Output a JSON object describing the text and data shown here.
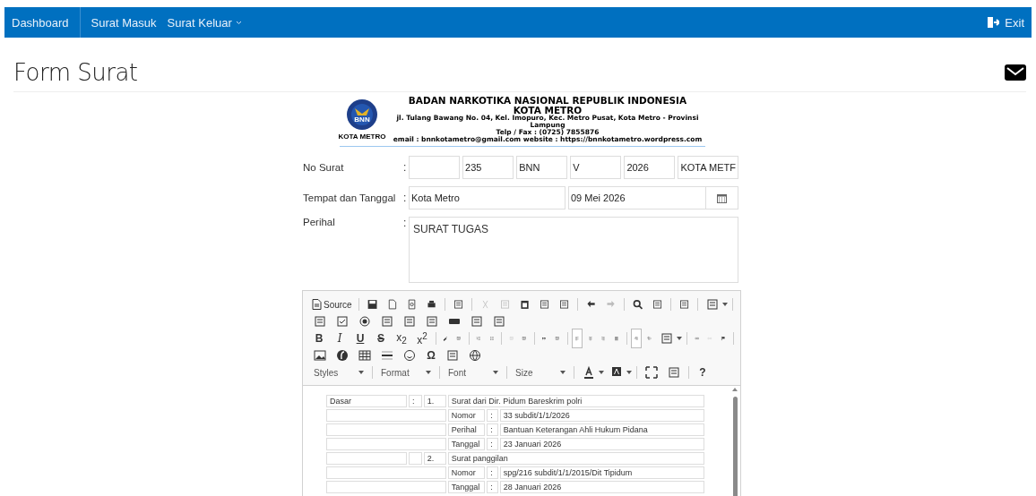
{
  "navbar": {
    "items": [
      {
        "label": "Dashboard",
        "kind": "link",
        "selected": false
      },
      {
        "label": "Surat Masuk",
        "kind": "link",
        "selected": false
      },
      {
        "label": "Surat Keluar",
        "kind": "dropdown",
        "selected": false
      }
    ],
    "exit": "Exit"
  },
  "page_title": "Form Surat",
  "letterhead": {
    "logo_text": "BNN",
    "logo_caption": "KOTA METRO",
    "lines": [
      "BADAN NARKOTIKA NASIONAL REPUBLIK INDONESIA",
      "KOTA METRO",
      "jl. Tulang Bawang No. 04, Kel. Imopuro, Kec. Metro Pusat, Kota Metro - Provinsi Lampung",
      "Telp / Fax : (0725) 7855876",
      "email : bnnkotametro@gmail.com website : https://bnnkotametro.wordpress.com"
    ]
  },
  "form": {
    "no_surat": {
      "label": "No Surat",
      "colon": ":",
      "parts": [
        {
          "kind": "empty"
        },
        {
          "kind": "filled",
          "value": "235"
        },
        {
          "kind": "filled",
          "value": "BNN"
        },
        {
          "kind": "filled",
          "value": "V"
        },
        {
          "kind": "filled",
          "value": "2026"
        },
        {
          "kind": "filled",
          "value": "KOTA METF"
        }
      ]
    },
    "tempat_tanggal": {
      "label": "Tempat dan Tanggal",
      "colon": ":",
      "place": "Kota Metro",
      "date": "09 Mei 2026"
    },
    "perihal": {
      "label": "Perihal",
      "colon": ":",
      "value": "SURAT TUGAS"
    }
  },
  "toolbar": [
    [
      {
        "kind": "source",
        "text": "Source",
        "disabled": false
      },
      {
        "kind": "sep"
      },
      {
        "kind": "icon",
        "disabled": false,
        "on": false
      },
      {
        "kind": "icon",
        "disabled": false,
        "on": false
      },
      {
        "kind": "icon",
        "disabled": false,
        "on": false
      },
      {
        "kind": "icon",
        "disabled": false,
        "on": false
      },
      {
        "kind": "sep"
      },
      {
        "kind": "icon",
        "disabled": false,
        "on": false
      },
      {
        "kind": "sep"
      },
      {
        "kind": "icon",
        "disabled": true,
        "on": false
      },
      {
        "kind": "icon",
        "disabled": true,
        "on": false
      },
      {
        "kind": "icon",
        "disabled": false,
        "on": false
      },
      {
        "kind": "icon",
        "disabled": false,
        "on": false
      },
      {
        "kind": "icon",
        "disabled": false,
        "on": false
      },
      {
        "kind": "sep"
      },
      {
        "kind": "icon",
        "disabled": false,
        "on": false
      },
      {
        "kind": "icon",
        "disabled": true,
        "on": false
      },
      {
        "kind": "sep"
      },
      {
        "kind": "icon",
        "disabled": false,
        "on": false
      },
      {
        "kind": "icon",
        "disabled": false,
        "on": false
      },
      {
        "kind": "sep"
      },
      {
        "kind": "icon",
        "disabled": false,
        "on": false
      },
      {
        "kind": "sep"
      },
      {
        "kind": "icon",
        "disabled": false,
        "on": false
      },
      {
        "kind": "sep"
      }
    ],
    [
      {
        "kind": "icon",
        "disabled": false,
        "on": false
      },
      {
        "kind": "icon",
        "disabled": false,
        "on": false
      },
      {
        "kind": "icon",
        "disabled": false,
        "on": false
      },
      {
        "kind": "icon",
        "disabled": false,
        "on": false
      },
      {
        "kind": "icon",
        "disabled": false,
        "on": false
      },
      {
        "kind": "icon",
        "disabled": false,
        "on": false
      },
      {
        "kind": "icon",
        "disabled": false,
        "on": false
      },
      {
        "kind": "icon",
        "disabled": false,
        "on": false
      },
      {
        "kind": "icon",
        "disabled": false,
        "on": false
      }
    ],
    [
      {
        "kind": "glyph",
        "text": "B",
        "disabled": false,
        "on": false
      },
      {
        "kind": "glyph",
        "text": "I",
        "disabled": false,
        "on": false
      },
      {
        "kind": "glyph",
        "text": "U",
        "disabled": false,
        "on": false
      },
      {
        "kind": "glyph",
        "text": "S",
        "disabled": false,
        "on": false
      },
      {
        "kind": "glyph",
        "text": "x$_{2}$",
        "disabled": false,
        "on": false
      },
      {
        "kind": "glyph",
        "text": "x$^{2}$",
        "disabled": false,
        "on": false
      },
      {
        "kind": "sep"
      },
      {
        "kind": "icon",
        "disabled": false,
        "on": false
      },
      {
        "kind": "icon",
        "disabled": false,
        "on": false
      },
      {
        "kind": "sep"
      },
      {
        "kind": "icon",
        "disabled": false,
        "on": false
      },
      {
        "kind": "icon",
        "disabled": false,
        "on": false
      },
      {
        "kind": "sep"
      },
      {
        "kind": "icon",
        "disabled": true,
        "on": false
      },
      {
        "kind": "icon",
        "disabled": false,
        "on": false
      },
      {
        "kind": "sep"
      },
      {
        "kind": "icon",
        "disabled": false,
        "on": false
      },
      {
        "kind": "icon",
        "disabled": false,
        "on": false
      },
      {
        "kind": "sep"
      },
      {
        "kind": "icon",
        "disabled": false,
        "on": true
      },
      {
        "kind": "icon",
        "disabled": false,
        "on": false
      },
      {
        "kind": "icon",
        "disabled": false,
        "on": false
      },
      {
        "kind": "icon",
        "disabled": false,
        "on": false
      },
      {
        "kind": "sep"
      },
      {
        "kind": "icon",
        "disabled": false,
        "on": true
      },
      {
        "kind": "icon",
        "disabled": false,
        "on": false
      },
      {
        "kind": "icon",
        "disabled": false,
        "on": false
      },
      {
        "kind": "sep"
      },
      {
        "kind": "icon",
        "disabled": false,
        "on": false
      },
      {
        "kind": "icon",
        "disabled": true,
        "on": false
      },
      {
        "kind": "icon",
        "disabled": false,
        "on": false
      },
      {
        "kind": "sep"
      }
    ],
    [
      {
        "kind": "icon",
        "disabled": false,
        "on": false
      },
      {
        "kind": "icon",
        "disabled": false,
        "on": false
      },
      {
        "kind": "icon",
        "disabled": false,
        "on": false
      },
      {
        "kind": "icon",
        "disabled": false,
        "on": false
      },
      {
        "kind": "icon",
        "disabled": false,
        "on": false
      },
      {
        "kind": "glyph",
        "text": "Ω",
        "disabled": false,
        "on": false
      },
      {
        "kind": "icon",
        "disabled": false,
        "on": false
      },
      {
        "kind": "icon",
        "disabled": false,
        "on": false
      }
    ],
    [
      {
        "kind": "combo",
        "text": "Styles",
        "disabled": false
      },
      {
        "kind": "sep"
      },
      {
        "kind": "combo",
        "text": "Format",
        "disabled": false
      },
      {
        "kind": "sep"
      },
      {
        "kind": "combo",
        "text": "Font",
        "disabled": false
      },
      {
        "kind": "sep"
      },
      {
        "kind": "combo",
        "text": "Size",
        "disabled": false
      },
      {
        "kind": "sep"
      },
      {
        "kind": "icon",
        "disabled": false,
        "on": false
      },
      {
        "kind": "icon",
        "disabled": false,
        "on": false
      },
      {
        "kind": "sep"
      },
      {
        "kind": "icon",
        "disabled": false,
        "on": false
      },
      {
        "kind": "icon",
        "disabled": false,
        "on": false
      },
      {
        "kind": "sep"
      },
      {
        "kind": "glyph",
        "text": "?",
        "disabled": false,
        "on": false
      }
    ]
  ],
  "document": {
    "rows": [
      {
        "kind": "item",
        "label": "Dasar",
        "colon": ":",
        "number": "1.",
        "text": "Surat dari Dir. Pidum Bareskrim polri"
      },
      {
        "kind": "detail",
        "key": "Nomor",
        "colon": ":",
        "value": "33 subdit/1/1/2026"
      },
      {
        "kind": "detail",
        "key": "Perihal",
        "colon": ":",
        "value": "Bantuan Keterangan Ahli Hukum Pidana"
      },
      {
        "kind": "detail",
        "key": "Tanggal",
        "colon": ":",
        "value": "23 Januari 2026"
      },
      {
        "kind": "item",
        "number": "2.",
        "text": "Surat panggilan"
      },
      {
        "kind": "detail",
        "key": "Nomor",
        "colon": ":",
        "value": "spg/216 subdit/1/1/2015/Dit Tipidum"
      },
      {
        "kind": "detail",
        "key": "Tanggal",
        "colon": ":",
        "value": "28 Januari 2026"
      }
    ]
  }
}
